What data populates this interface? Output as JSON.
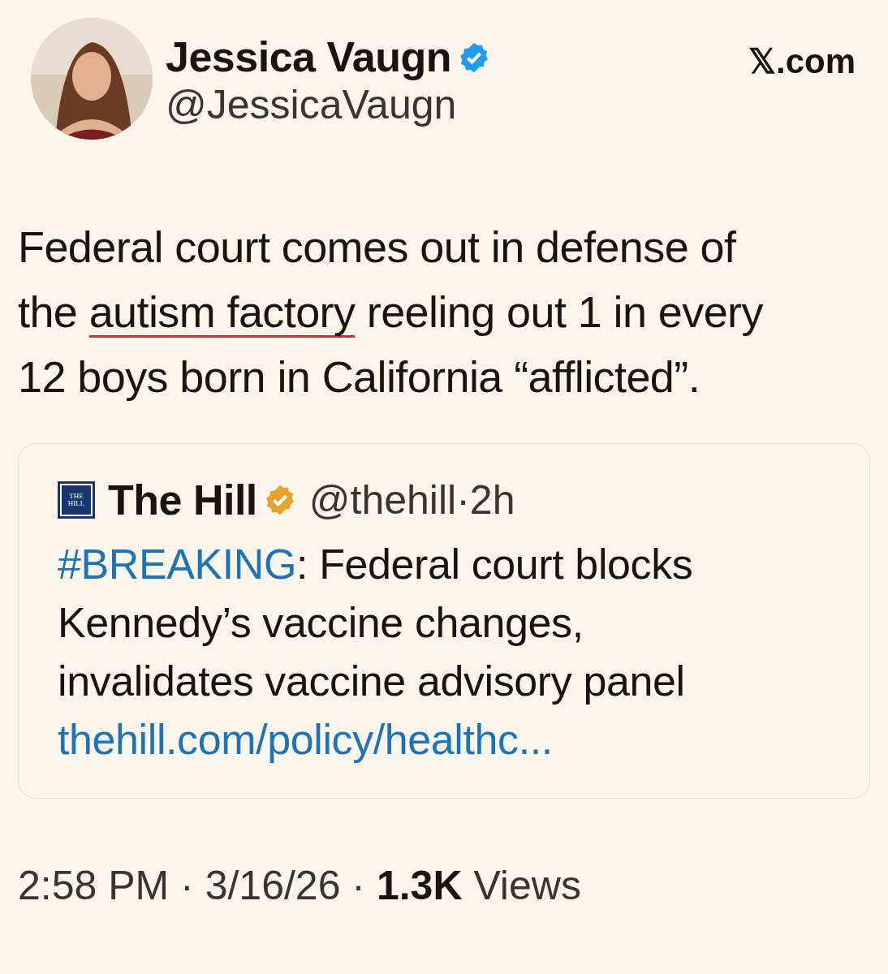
{
  "author": {
    "name": "Jessica Vaugn",
    "verified": true,
    "handle": "@JessicaVaugn"
  },
  "site": "𝕏.com",
  "tweet_text": [
    {
      "text": "Federal court comes out in defense of the ",
      "underlined": false
    },
    {
      "text": "autism factory",
      "underlined": true
    },
    {
      "text": " reeling out 1 in every 12 boys born in California “afflicted”.",
      "underlined": false
    }
  ],
  "quote": {
    "logo_text": "THE HILL",
    "name": "The Hill",
    "verified": true,
    "handle": "@thehill",
    "separator": "·",
    "time": "2h",
    "hashtag": "#BREAKING",
    "text": ": Federal court blocks Kennedy’s vaccine changes, invalidates vaccine advisory panel",
    "link": "thehill.com/policy/healthc..."
  },
  "footer": {
    "parts": [
      "2:58 PM",
      "·",
      "3/16/26",
      "·"
    ],
    "views_count": "1.3K",
    "views_label": "Views"
  }
}
